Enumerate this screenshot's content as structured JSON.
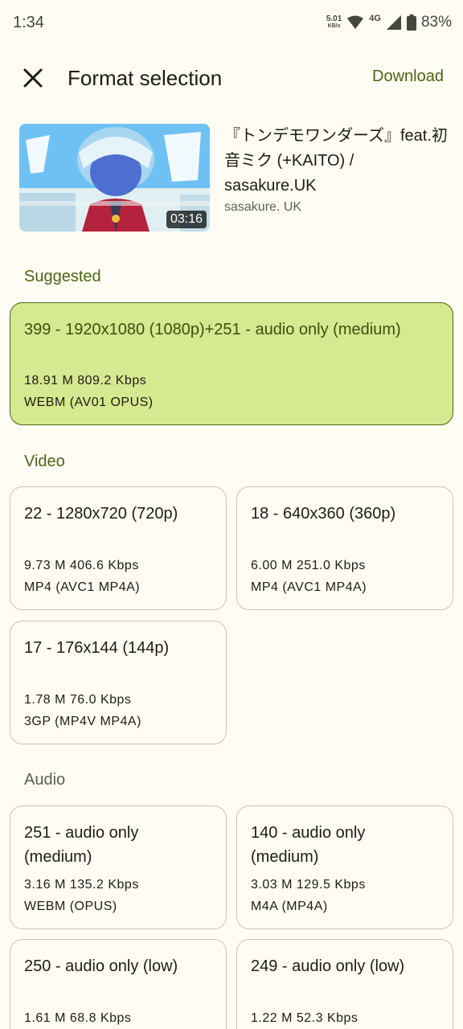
{
  "status_bar": {
    "time": "1:34",
    "net_speed": "5.01",
    "net_unit": "KB/s",
    "network": "4G",
    "battery": "83%"
  },
  "top_bar": {
    "title": "Format selection",
    "download_label": "Download"
  },
  "video": {
    "title": "『トンデモワンダーズ』feat.初音ミク (+KAITO)  / sasakure.UK",
    "channel": "sasakure. UK",
    "duration": "03:16"
  },
  "sections": {
    "suggested": "Suggested",
    "video": "Video",
    "audio": "Audio"
  },
  "suggested": {
    "title": "399 - 1920x1080 (1080p)+251 - audio only (medium)",
    "size_bitrate": "18.91 M 809.2 Kbps",
    "container": "WEBM (AV01 OPUS)"
  },
  "video_formats": [
    {
      "title": "22 - 1280x720 (720p)",
      "size_bitrate": "9.73 M 406.6 Kbps",
      "container": "MP4 (AVC1 MP4A)"
    },
    {
      "title": "18 - 640x360 (360p)",
      "size_bitrate": "6.00 M 251.0 Kbps",
      "container": "MP4 (AVC1 MP4A)"
    },
    {
      "title": "17 - 176x144 (144p)",
      "size_bitrate": "1.78 M 76.0 Kbps",
      "container": "3GP (MP4V MP4A)"
    }
  ],
  "audio_formats": [
    {
      "title_line1": "251 - audio only",
      "title_line2": "(medium)",
      "size_bitrate": "3.16 M 135.2 Kbps",
      "container": "WEBM (OPUS)"
    },
    {
      "title_line1": "140 - audio only",
      "title_line2": "(medium)",
      "size_bitrate": "3.03 M 129.5 Kbps",
      "container": "M4A (MP4A)"
    },
    {
      "title_line1": "250 - audio only (low)",
      "size_bitrate": "1.61 M 68.8 Kbps"
    },
    {
      "title_line1": "249 - audio only (low)",
      "size_bitrate": "1.22 M 52.3 Kbps"
    }
  ],
  "colors": {
    "background": "#fefcf3",
    "accent": "#4c6414",
    "selected_card": "#d6e890",
    "card_border": "#c6c8bb"
  }
}
